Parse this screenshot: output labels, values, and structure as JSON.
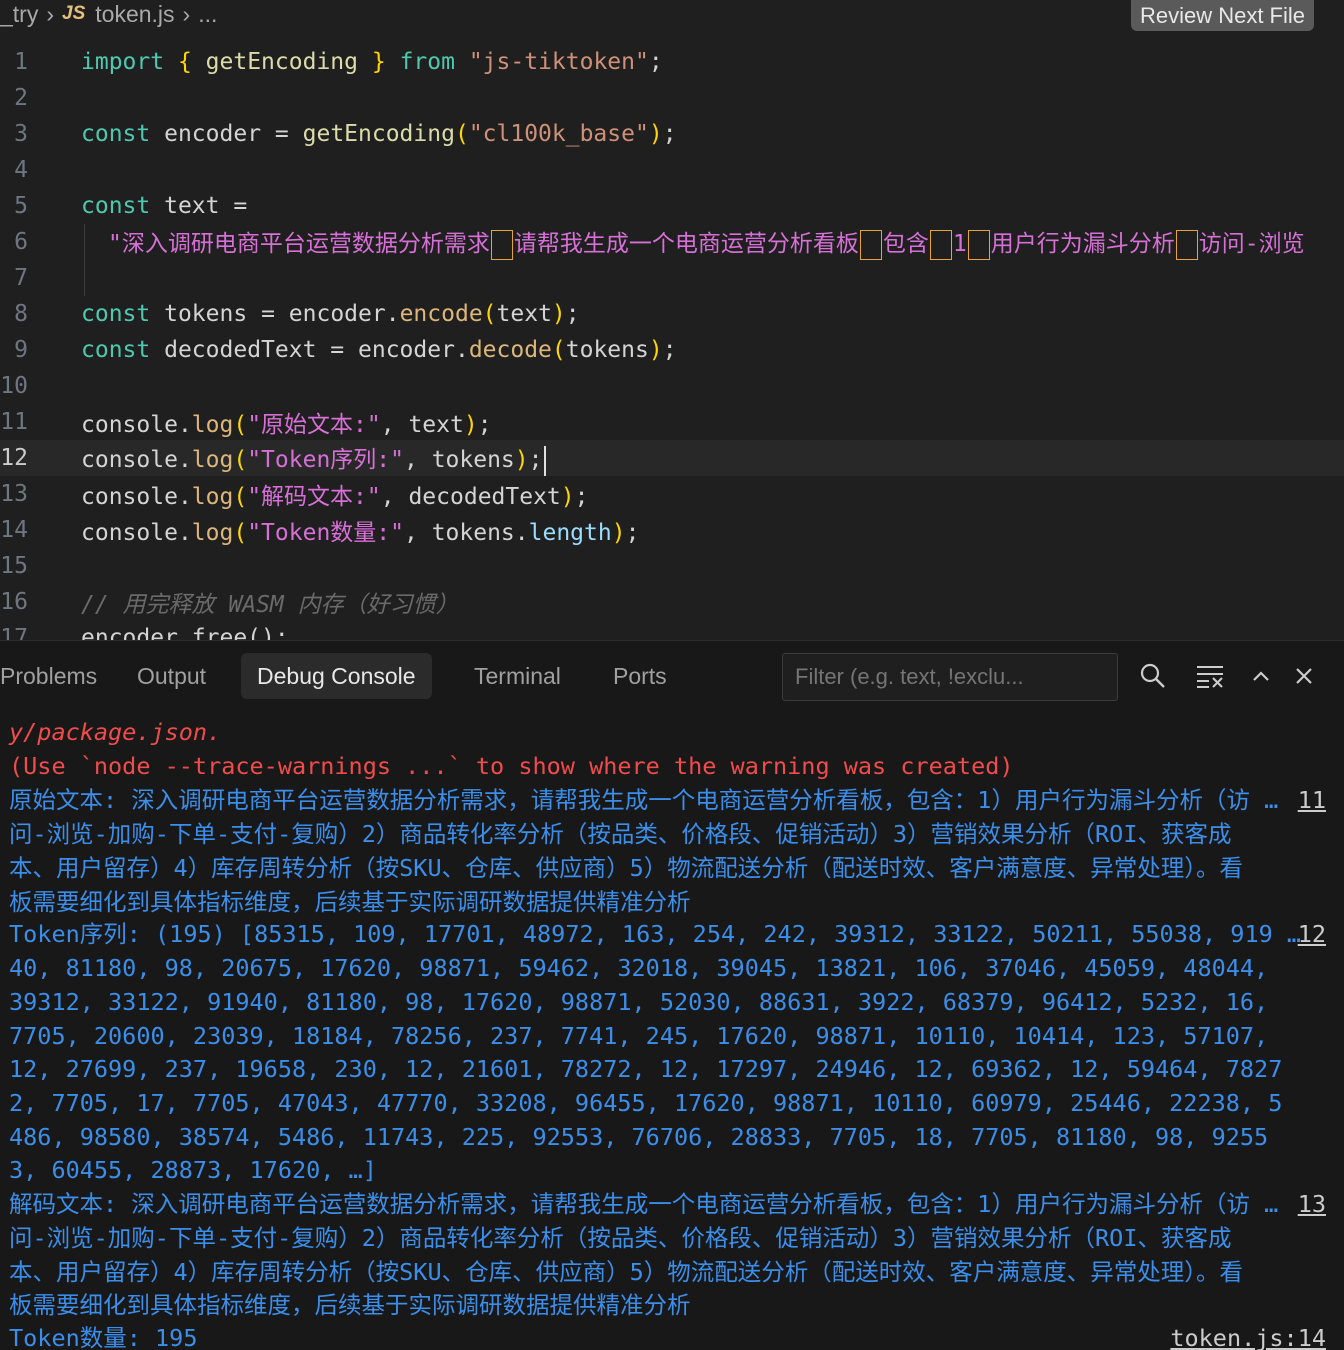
{
  "breadcrumb": {
    "folder": "_try",
    "file": "token.js",
    "more": "...",
    "lang_badge": "JS"
  },
  "review_button": "Review Next File",
  "editor": {
    "lines": [
      {
        "n": "1"
      },
      {
        "n": "2"
      },
      {
        "n": "3"
      },
      {
        "n": "4"
      },
      {
        "n": "5"
      },
      {
        "n": "6"
      },
      {
        "n": "7"
      },
      {
        "n": "8"
      },
      {
        "n": "9"
      },
      {
        "n": "10"
      },
      {
        "n": "11"
      },
      {
        "n": "12"
      },
      {
        "n": "13"
      },
      {
        "n": "14"
      },
      {
        "n": "15"
      },
      {
        "n": "16"
      },
      {
        "n": "17"
      }
    ],
    "l1": {
      "import": "import",
      "ob": "{",
      "name": "getEncoding",
      "cb": "}",
      "from": "from",
      "mod": "\"js-tiktoken\"",
      "semi": ";"
    },
    "l3": {
      "const": "const",
      "var": "encoder",
      "eq": "=",
      "fn": "getEncoding",
      "op": "(",
      "arg": "\"cl100k_base\"",
      "cp": ")",
      "semi": ";"
    },
    "l5": {
      "const": "const",
      "var": "text",
      "eq": "="
    },
    "l6": {
      "p1": "\"深入调研电商平台运营数据分析需求",
      "p2": "请帮我生成一个电商运营分析看板",
      "p3": "包含",
      "p4": "1",
      "p5": "用户行为漏斗分析",
      "p6": "访问-浏览"
    },
    "l8": {
      "const": "const",
      "var": "tokens",
      "eq": "=",
      "obj": "encoder",
      "dot": ".",
      "meth": "encode",
      "op": "(",
      "arg": "text",
      "cp": ")",
      "semi": ";"
    },
    "l9": {
      "const": "const",
      "var": "decodedText",
      "eq": "=",
      "obj": "encoder",
      "dot": ".",
      "meth": "decode",
      "op": "(",
      "arg": "tokens",
      "cp": ")",
      "semi": ";"
    },
    "l11": {
      "obj": "console",
      "meth": "log",
      "str": "\"原始文本:\"",
      "arg": "text"
    },
    "l12": {
      "obj": "console",
      "meth": "log",
      "str": "\"Token序列:\"",
      "arg": "tokens"
    },
    "l13": {
      "obj": "console",
      "meth": "log",
      "str": "\"解码文本:\"",
      "arg": "decodedText"
    },
    "l14": {
      "obj": "console",
      "meth": "log",
      "str": "\"Token数量:\"",
      "arg": "tokens",
      "prop": "length"
    },
    "l16": {
      "comment": "// 用完释放 WASM 内存（好习惯）"
    },
    "l17": {
      "code": "encoder.free();"
    }
  },
  "panel": {
    "tabs": [
      "Problems",
      "Output",
      "Debug Console",
      "Terminal",
      "Ports"
    ],
    "active_tab": "Debug Console",
    "filter_placeholder": "Filter (e.g. text, !exclu..."
  },
  "console": {
    "lines": [
      "y/package.json.",
      "(Use `node --trace-warnings ...` to show where the warning was created)",
      "原始文本: 深入调研电商平台运营数据分析需求，请帮我生成一个电商运营分析看板，包含：1）用户行为漏斗分析（访 …",
      "问-浏览-加购-下单-支付-复购）2）商品转化率分析（按品类、价格段、促销活动）3）营销效果分析（ROI、获客成",
      "本、用户留存）4）库存周转分析（按SKU、仓库、供应商）5）物流配送分析（配送时效、客户满意度、异常处理）。看",
      "板需要细化到具体指标维度，后续基于实际调研数据提供精准分析",
      "Token序列: (195) [85315, 109, 17701, 48972, 163, 254, 242, 39312, 33122, 50211, 55038, 919 …",
      "40, 81180, 98, 20675, 17620, 98871, 59462, 32018, 39045, 13821, 106, 37046, 45059, 48044,",
      "39312, 33122, 91940, 81180, 98, 17620, 98871, 52030, 88631, 3922, 68379, 96412, 5232, 16,",
      "7705, 20600, 23039, 18184, 78256, 237, 7741, 245, 17620, 98871, 10110, 10414, 123, 57107,",
      "12, 27699, 237, 19658, 230, 12, 21601, 78272, 12, 17297, 24946, 12, 69362, 12, 59464, 7827",
      "2, 7705, 17, 7705, 47043, 47770, 33208, 96455, 17620, 98871, 10110, 60979, 25446, 22238, 5",
      "486, 98580, 38574, 5486, 11743, 225, 92553, 76706, 28833, 7705, 18, 7705, 81180, 98, 9255",
      "3, 60455, 28873, 17620, …]",
      "解码文本: 深入调研电商平台运营数据分析需求，请帮我生成一个电商运营分析看板，包含：1）用户行为漏斗分析（访 …",
      "问-浏览-加购-下单-支付-复购）2）商品转化率分析（按品类、价格段、促销活动）3）营销效果分析（ROI、获客成",
      "本、用户留存）4）库存周转分析（按SKU、仓库、供应商）5）物流配送分析（配送时效、客户满意度、异常处理）。看",
      "板需要细化到具体指标维度，后续基于实际调研数据提供精准分析",
      "Token数量: 195"
    ],
    "sources": [
      "11",
      "12",
      "13",
      "token.js:14"
    ]
  },
  "colors": {
    "background": "#1f1f1f",
    "panel": "#181818",
    "error": "#f14c4c",
    "info": "#3b8eea"
  }
}
